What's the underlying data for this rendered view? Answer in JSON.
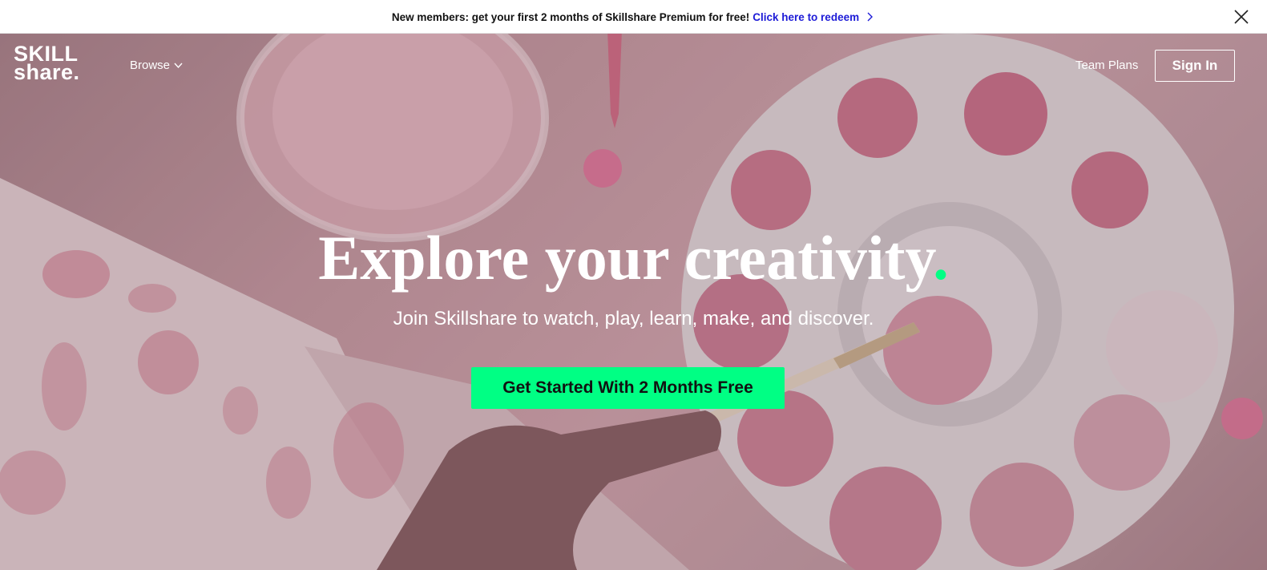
{
  "promo": {
    "message": "New members: get your first 2 months of Skillshare Premium for free!",
    "link_label": "Click here to redeem",
    "link_icon": "chevron-right-icon",
    "close_icon": "close-icon"
  },
  "nav": {
    "logo_line1": "SKILL",
    "logo_line2": "share.",
    "browse_label": "Browse",
    "browse_icon": "chevron-down-icon",
    "team_plans_label": "Team Plans",
    "sign_in_label": "Sign In"
  },
  "hero": {
    "headline": "Explore your creativity",
    "headline_dot": ".",
    "subline": "Join Skillshare to watch, play, learn, make, and discover.",
    "cta_label": "Get Started With 2 Months Free"
  },
  "colors": {
    "accent_green": "#00ff84",
    "link_blue": "#1d1bd7",
    "text_dark": "#111111"
  }
}
